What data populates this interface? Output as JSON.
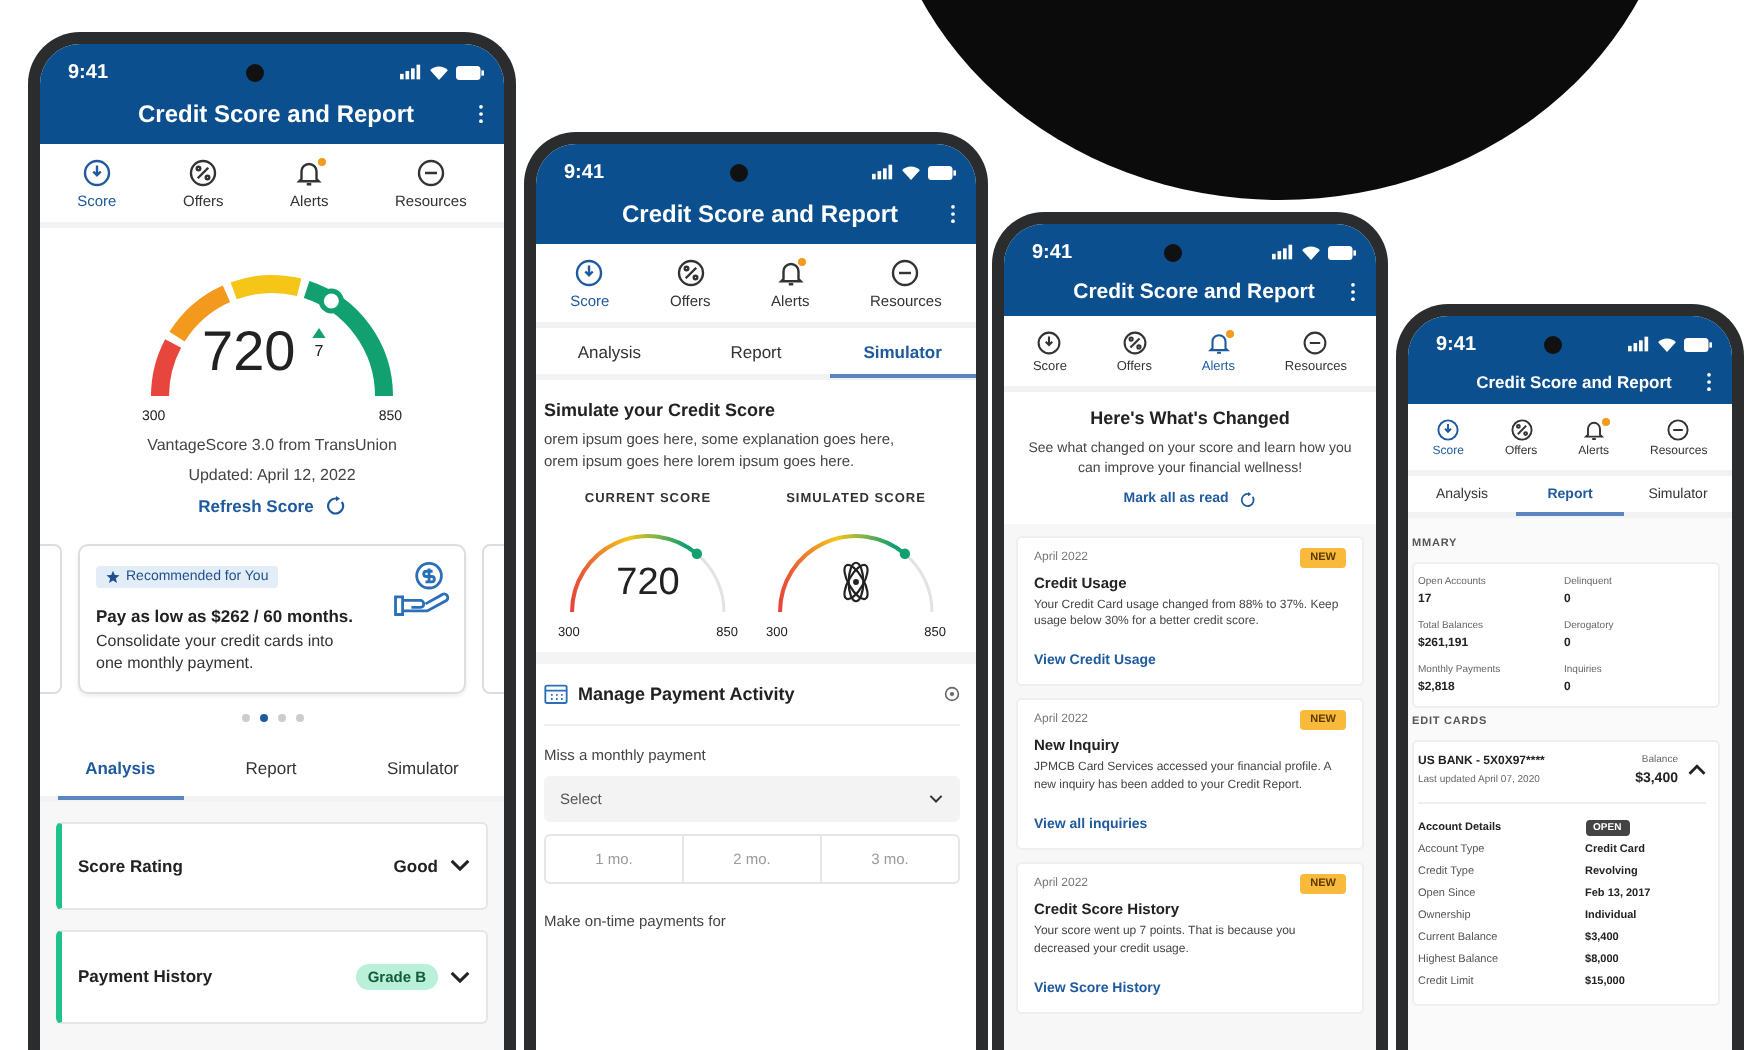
{
  "phones": [
    {
      "kind": "score",
      "time": "9:41",
      "title": "Credit Score and Report",
      "nav": [
        {
          "label": "Score",
          "selected": true,
          "badge": false
        },
        {
          "label": "Offers",
          "selected": false,
          "badge": false
        },
        {
          "label": "Alerts",
          "selected": false,
          "badge": true
        },
        {
          "label": "Resources",
          "selected": false,
          "badge": false
        }
      ],
      "gauge": {
        "score": "720",
        "change": "7",
        "min": "300",
        "max": "850"
      },
      "source": "VantageScore 3.0 from TransUnion",
      "updated": "Updated: April 12, 2022",
      "refresh": "Refresh Score",
      "offer": {
        "badge": "Recommended for You",
        "headline": "Pay as low as $262 / 60 months.",
        "text": "Consolidate your credit cards into one monthly payment."
      },
      "dots": [
        {
          "selected": false
        },
        {
          "selected": true
        },
        {
          "selected": false
        },
        {
          "selected": false
        }
      ],
      "tabs": [
        {
          "label": "Analysis",
          "selected": true
        },
        {
          "label": "Report",
          "selected": false
        },
        {
          "label": "Simulator",
          "selected": false
        }
      ],
      "accordions": [
        {
          "label": "Score Rating",
          "kind": "text",
          "value": "Good"
        },
        {
          "label": "Payment History",
          "kind": "pill",
          "value": "Grade B"
        }
      ]
    },
    {
      "kind": "simulator",
      "time": "9:41",
      "title": "Credit Score and Report",
      "nav": [
        {
          "label": "Score",
          "selected": true,
          "badge": false
        },
        {
          "label": "Offers",
          "selected": false,
          "badge": false
        },
        {
          "label": "Alerts",
          "selected": false,
          "badge": true
        },
        {
          "label": "Resources",
          "selected": false,
          "badge": false
        }
      ],
      "tabs": [
        {
          "label": "Analysis",
          "selected": false
        },
        {
          "label": "Report",
          "selected": false
        },
        {
          "label": "Simulator",
          "selected": true
        }
      ],
      "heading": "Simulate your Credit Score",
      "lines": [
        "orem ipsum goes here, some explanation goes here,",
        "orem ipsum goes here lorem ipsum goes here."
      ],
      "gauges": [
        {
          "label": "CURRENT SCORE",
          "kind": "score",
          "score": "720",
          "min": "300",
          "max": "850"
        },
        {
          "label": "SIMULATED SCORE",
          "kind": "atom",
          "min": "300",
          "max": "850"
        }
      ],
      "section": "Manage Payment Activity",
      "field_label": "Miss a monthly payment",
      "select": {
        "placeholder": "Select"
      },
      "months": [
        {
          "label": "1 mo.",
          "selected": false
        },
        {
          "label": "2 mo.",
          "selected": false
        },
        {
          "label": "3 mo.",
          "selected": false
        }
      ],
      "next_label": "Make on-time payments for"
    },
    {
      "kind": "alerts",
      "time": "9:41",
      "title": "Credit Score and Report",
      "nav": [
        {
          "label": "Score",
          "selected": false,
          "badge": false
        },
        {
          "label": "Offers",
          "selected": false,
          "badge": false
        },
        {
          "label": "Alerts",
          "selected": true,
          "badge": true
        },
        {
          "label": "Resources",
          "selected": false,
          "badge": false
        }
      ],
      "heading": "Here's What's Changed",
      "intro": "See what changed on your score and learn how you can improve your financial wellness!",
      "mark_read": "Mark all as read",
      "cards": [
        {
          "date": "April 2022",
          "badge": "NEW",
          "title": "Credit Usage",
          "text": "Your Credit Card usage changed from 88% to 37%. Keep usage below 30% for a better credit score.",
          "link": "View Credit Usage"
        },
        {
          "date": "April 2022",
          "badge": "NEW",
          "title": "New Inquiry",
          "text": "JPMCB Card Services accessed your financial profile. A new inquiry has been added to your Credit Report.",
          "link": "View all inquiries"
        },
        {
          "date": "April 2022",
          "badge": "NEW",
          "title": "Credit Score History",
          "text": "Your score went up 7 points. That is because you decreased your credit usage.",
          "link": "View Score History"
        }
      ]
    },
    {
      "kind": "report",
      "time": "9:41",
      "title": "Credit Score and Report",
      "nav": [
        {
          "label": "Score",
          "selected": true,
          "badge": false
        },
        {
          "label": "Offers",
          "selected": false,
          "badge": false
        },
        {
          "label": "Alerts",
          "selected": false,
          "badge": true
        },
        {
          "label": "Resources",
          "selected": false,
          "badge": false
        }
      ],
      "tabs": [
        {
          "label": "Analysis",
          "selected": false
        },
        {
          "label": "Report",
          "selected": true
        },
        {
          "label": "Simulator",
          "selected": false
        }
      ],
      "summary_label": "MMARY",
      "summary": [
        {
          "label": "Open Accounts",
          "value": "17"
        },
        {
          "label": "Delinquent",
          "value": "0"
        },
        {
          "label": "Total Balances",
          "value": "$261,191"
        },
        {
          "label": "Derogatory",
          "value": "0"
        },
        {
          "label": "Monthly Payments",
          "value": "$2,818"
        },
        {
          "label": "Inquiries",
          "value": "0"
        }
      ],
      "cards_label": "EDIT CARDS",
      "account": {
        "name": "US BANK - 5X0X97****",
        "updated": "Last updated April 07, 2020",
        "balance_label": "Balance",
        "balance": "$3,400",
        "details_label": "Account Details",
        "status": "OPEN",
        "details": [
          {
            "label": "Account Type",
            "value": "Credit Card"
          },
          {
            "label": "Credit Type",
            "value": "Revolving"
          },
          {
            "label": "Open Since",
            "value": "Feb 13, 2017"
          },
          {
            "label": "Ownership",
            "value": "Individual"
          },
          {
            "label": "Current Balance",
            "value": "$3,400"
          },
          {
            "label": "Highest Balance",
            "value": "$8,000"
          },
          {
            "label": "Credit Limit",
            "value": "$15,000"
          }
        ]
      }
    }
  ]
}
